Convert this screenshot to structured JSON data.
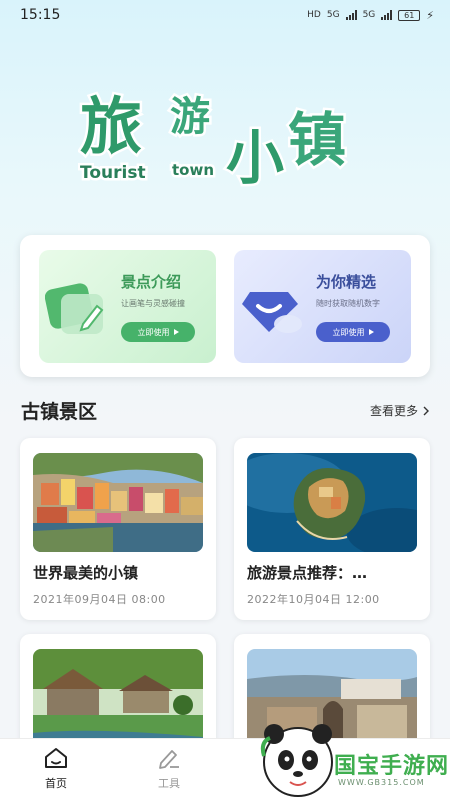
{
  "status_bar": {
    "time": "15:15",
    "net1": "HD",
    "net2": "5G",
    "net3": "5G",
    "battery": "61"
  },
  "logo": {
    "chars": [
      "旅",
      "游",
      "小",
      "镇"
    ],
    "en_left": "Tourist",
    "en_right": "town"
  },
  "features": [
    {
      "title": "景点介绍",
      "subtitle": "让画笔与灵感碰撞",
      "button": "立即使用"
    },
    {
      "title": "为你精选",
      "subtitle": "随时获取随机数字",
      "button": "立即使用"
    }
  ],
  "section": {
    "title": "古镇景区",
    "more": "查看更多"
  },
  "spots": [
    {
      "title": "世界最美的小镇",
      "time": "2021年09月04日 08:00"
    },
    {
      "title": "旅游景点推荐：…",
      "time": "2022年10月04日 12:00"
    }
  ],
  "nav": {
    "home": "首页",
    "tools": "工具"
  },
  "watermark": {
    "name": "国宝手游网",
    "url": "WWW.GB315.COM"
  },
  "colors": {
    "accent_green": "#46b26a",
    "accent_blue": "#4a60cc",
    "logo_green": "#2f9a6a"
  }
}
